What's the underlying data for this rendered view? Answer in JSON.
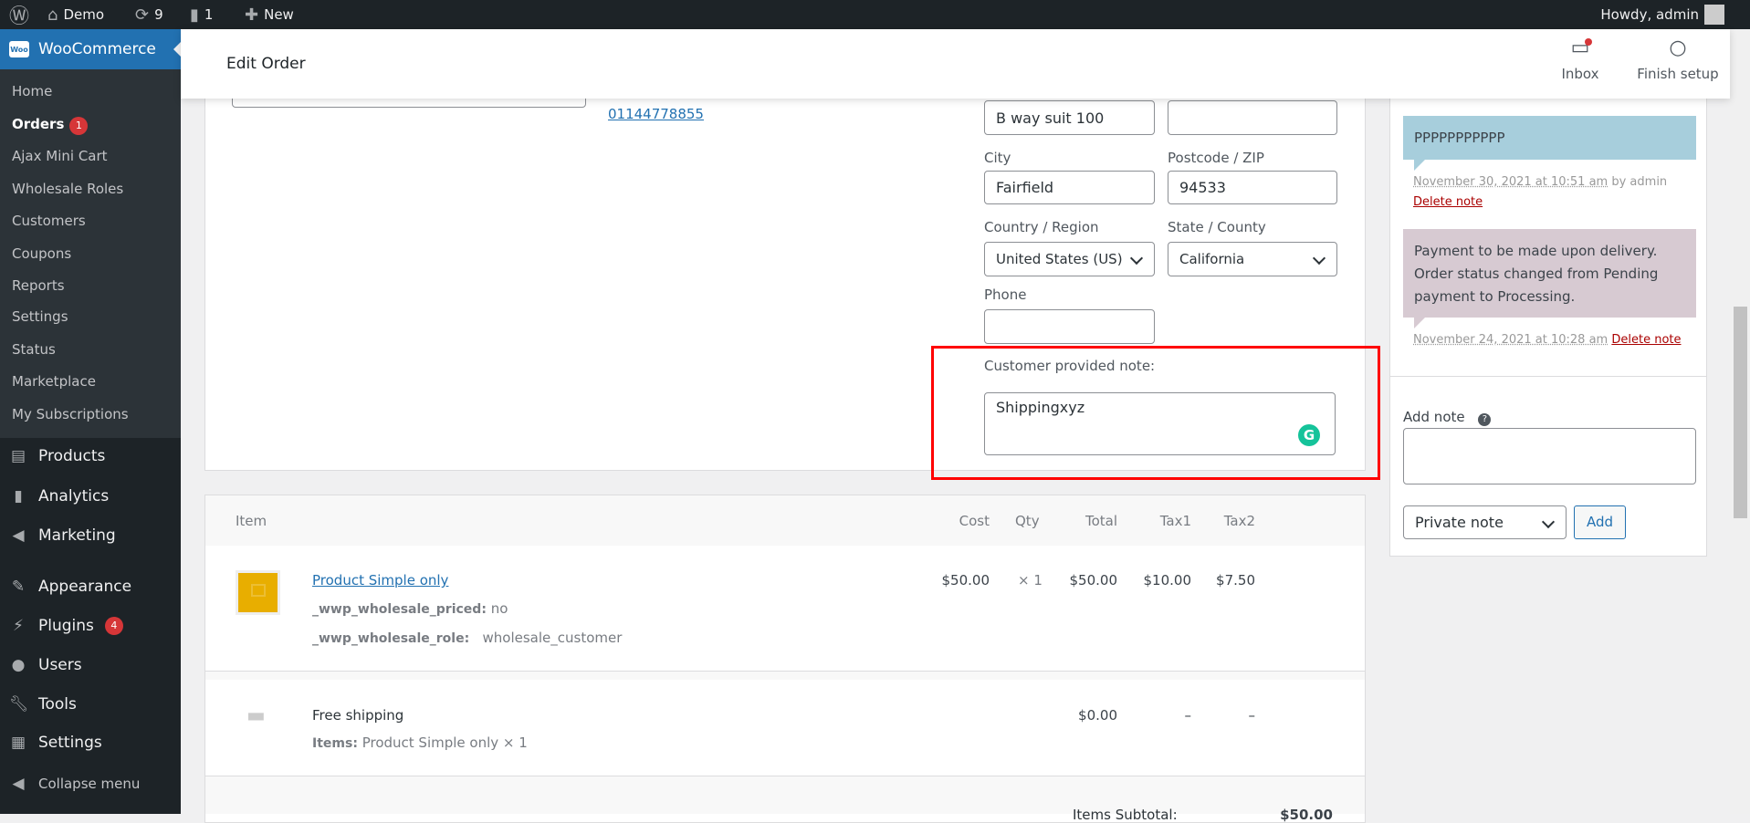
{
  "adminbar": {
    "site": "Demo",
    "updates": "9",
    "comments": "1",
    "new": "New",
    "howdy": "Howdy, admin"
  },
  "sidebar": {
    "brand": "WooCommerce",
    "submenu": [
      {
        "label": "Home"
      },
      {
        "label": "Orders",
        "badge": "1"
      },
      {
        "label": "Ajax Mini Cart"
      },
      {
        "label": "Wholesale Roles"
      },
      {
        "label": "Customers"
      },
      {
        "label": "Coupons"
      },
      {
        "label": "Reports"
      },
      {
        "label": "Settings"
      },
      {
        "label": "Status"
      },
      {
        "label": "Marketplace"
      },
      {
        "label": "My Subscriptions"
      }
    ],
    "menu": [
      {
        "label": "Products",
        "icon": "archive-icon"
      },
      {
        "label": "Analytics",
        "icon": "bar-chart-icon"
      },
      {
        "label": "Marketing",
        "icon": "megaphone-icon"
      },
      {
        "label": "Appearance",
        "icon": "brush-icon"
      },
      {
        "label": "Plugins",
        "icon": "plug-icon",
        "badge": "4"
      },
      {
        "label": "Users",
        "icon": "user-icon"
      },
      {
        "label": "Tools",
        "icon": "wrench-icon"
      },
      {
        "label": "Settings",
        "icon": "settings-icon"
      },
      {
        "label": "Collapse menu",
        "icon": "collapse-icon"
      }
    ]
  },
  "header": {
    "title": "Edit Order",
    "inbox": "Inbox",
    "finish_setup": "Finish setup"
  },
  "billing": {
    "phone": "01144778855"
  },
  "shipping": {
    "address2_value": "B way suit 100",
    "address_extra_value": "",
    "city_label": "City",
    "city": "Fairfield",
    "postcode_label": "Postcode / ZIP",
    "postcode": "94533",
    "country_label": "Country / Region",
    "country": "United States (US)",
    "state_label": "State / County",
    "state": "California",
    "phone_label": "Phone",
    "phone": "",
    "note_label": "Customer provided note:",
    "note": "Shippingxyz"
  },
  "items": {
    "headers": {
      "item": "Item",
      "cost": "Cost",
      "qty": "Qty",
      "total": "Total",
      "tax1": "Tax1",
      "tax2": "Tax2"
    },
    "product": {
      "name": "Product Simple only",
      "meta": [
        {
          "key": "_wwp_wholesale_priced:",
          "value": "no"
        },
        {
          "key": "_wwp_wholesale_role:",
          "value": "wholesale_customer"
        }
      ],
      "cost": "$50.00",
      "qty": "× 1",
      "total": "$50.00",
      "tax1": "$10.00",
      "tax2": "$7.50"
    },
    "shipping": {
      "name": "Free shipping",
      "items_label": "Items:",
      "items_value": "Product Simple only × 1",
      "total": "$0.00",
      "tax1": "–",
      "tax2": "–"
    },
    "subtotal_label": "Items Subtotal:",
    "subtotal": "$50.00"
  },
  "notes": {
    "list": [
      {
        "text": "PPPPPPPPPPP",
        "date": "November 30, 2021 at 10:51 am",
        "by": "by admin",
        "delete": "Delete note",
        "color": "#a7cedc"
      },
      {
        "text": "Payment to be made upon delivery. Order status changed from Pending payment to Processing.",
        "date": "November 24, 2021 at 10:28 am",
        "delete": "Delete note",
        "color": "#d7cad2"
      }
    ],
    "add_label": "Add note",
    "add_value": "",
    "type": "Private note",
    "add_button": "Add"
  },
  "colors": {
    "highlight": "#ff0000",
    "accent": "#2271b1"
  }
}
